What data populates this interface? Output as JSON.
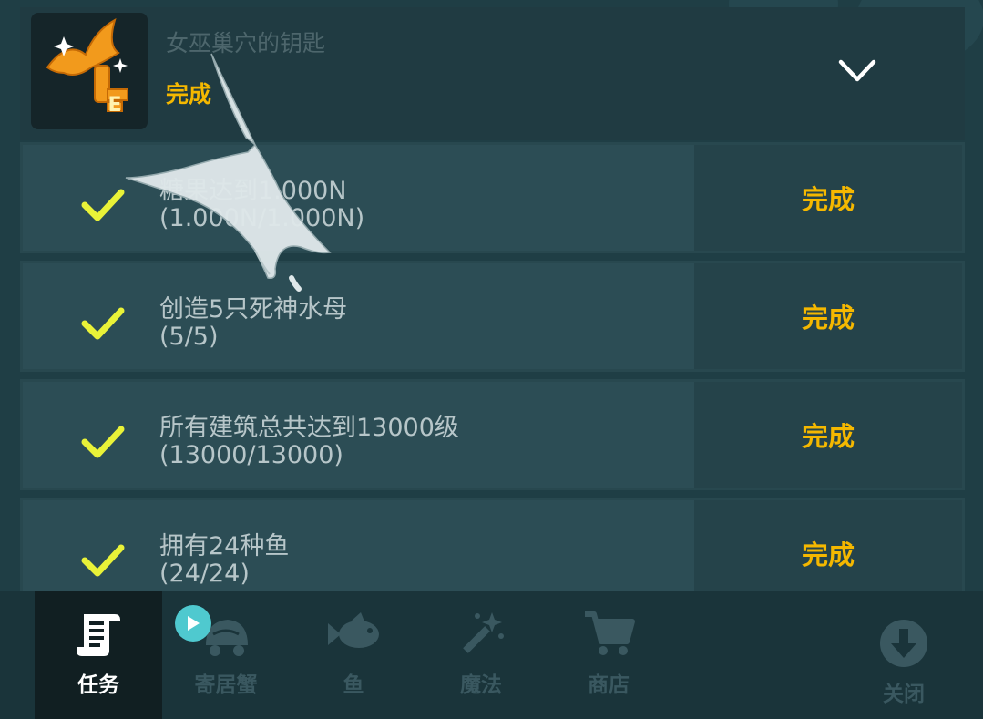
{
  "header": {
    "title": "女巫巢穴的钥匙",
    "status": "完成",
    "icon": "bat-key-icon",
    "collapse_icon": "chevron-down-icon"
  },
  "tasks": [
    {
      "name": "糖果达到1.000N",
      "progress": "(1.000N/1.000N)",
      "status": "完成"
    },
    {
      "name": "创造5只死神水母",
      "progress": "(5/5)",
      "status": "完成"
    },
    {
      "name": "所有建筑总共达到13000级",
      "progress": "(13000/13000)",
      "status": "完成"
    },
    {
      "name": "拥有24种鱼",
      "progress": "(24/24)",
      "status": "完成"
    }
  ],
  "tabs": [
    {
      "label": "任务",
      "icon": "scroll-icon",
      "active": true
    },
    {
      "label": "寄居蟹",
      "icon": "hermit-crab-icon",
      "active": false
    },
    {
      "label": "鱼",
      "icon": "fish-icon",
      "active": false
    },
    {
      "label": "魔法",
      "icon": "magic-wand-icon",
      "active": false
    },
    {
      "label": "商店",
      "icon": "cart-icon",
      "active": false
    }
  ],
  "close": {
    "label": "关闭",
    "icon": "download-arrow-icon"
  },
  "colors": {
    "accent": "#f5b800",
    "check": "#e9f238",
    "background": "#1f3e45",
    "badge": "#4fc9cf"
  }
}
